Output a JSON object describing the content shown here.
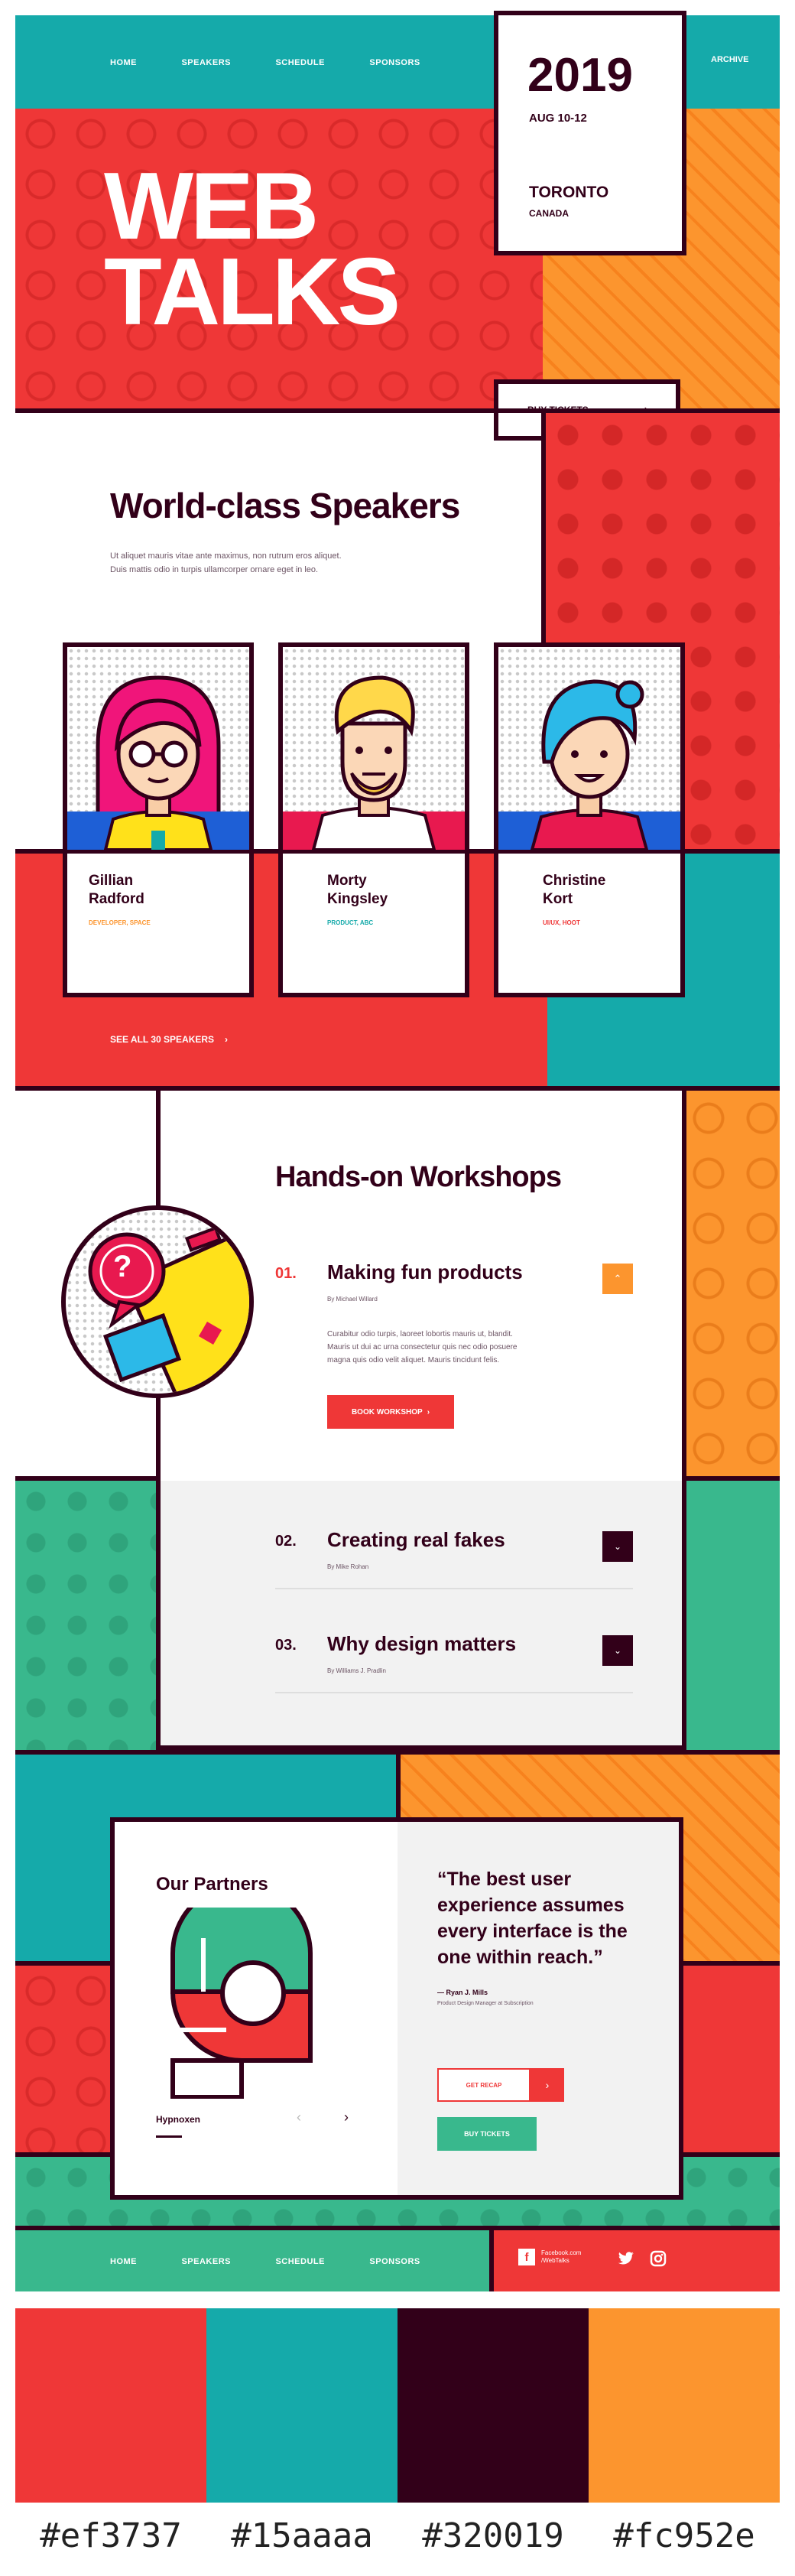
{
  "nav": {
    "home": "HOME",
    "speakers": "SPEAKERS",
    "schedule": "SCHEDULE",
    "sponsors": "SPONSORS",
    "archive": "ARCHIVE"
  },
  "hero": {
    "title_line1": "WEB",
    "title_line2": "TALKS",
    "year": "2019",
    "dates": "AUG 10-12",
    "city": "TORONTO",
    "country": "CANADA",
    "buy_tickets": "BUY TICKETS"
  },
  "speakers": {
    "title": "World-class Speakers",
    "intro_line1": "Ut aliquet mauris vitae ante maximus, non rutrum eros aliquet.",
    "intro_line2": "Duis mattis odio in turpis ullamcorper ornare eget in leo.",
    "items": [
      {
        "first": "Gillian",
        "last": "Radford",
        "role": "DEVELOPER, SPACE"
      },
      {
        "first": "Morty",
        "last": "Kingsley",
        "role": "PRODUCT, ABC"
      },
      {
        "first": "Christine",
        "last": "Kort",
        "role": "UI/UX, HOOT"
      }
    ],
    "see_all": "SEE ALL 30 SPEAKERS"
  },
  "workshops": {
    "title": "Hands-on Workshops",
    "items": [
      {
        "num": "01.",
        "title": "Making fun products",
        "by": "By Michael Willard"
      },
      {
        "num": "02.",
        "title": "Creating real fakes",
        "by": "By Mike Rohan"
      },
      {
        "num": "03.",
        "title": "Why design matters",
        "by": "By Williams J. Pradlin"
      }
    ],
    "desc_line1": "Curabitur odio turpis, laoreet lobortis mauris ut, blandit.",
    "desc_line2": "Mauris ut dui ac urna consectetur quis nec odio posuere",
    "desc_line3": "magna quis odio velit aliquet. Mauris tincidunt felis.",
    "book_button": "BOOK WORKSHOP",
    "icon_question": "?"
  },
  "partners": {
    "title": "Our Partners",
    "partner_name": "Hypnoxen",
    "quote_line1": "“The best user",
    "quote_line2": "experience assumes",
    "quote_line3": "every interface is the",
    "quote_line4": "one within reach.”",
    "author": "— Ryan J. Mills",
    "author_role": "Product Design Manager at Subscription",
    "email_label": "GET RECAP",
    "buy_tickets": "BUY TICKETS"
  },
  "footer": {
    "home": "HOME",
    "speakers": "SPEAKERS",
    "schedule": "SCHEDULE",
    "sponsors": "SPONSORS",
    "fb_line1": "Facebook.com",
    "fb_line2": "/WebTalks"
  },
  "palette": {
    "red": "#ef3737",
    "teal": "#15aaaa",
    "dark": "#320019",
    "orange": "#fc952e",
    "labels": [
      "#ef3737",
      "#15aaaa",
      "#320019",
      "#fc952e"
    ]
  }
}
